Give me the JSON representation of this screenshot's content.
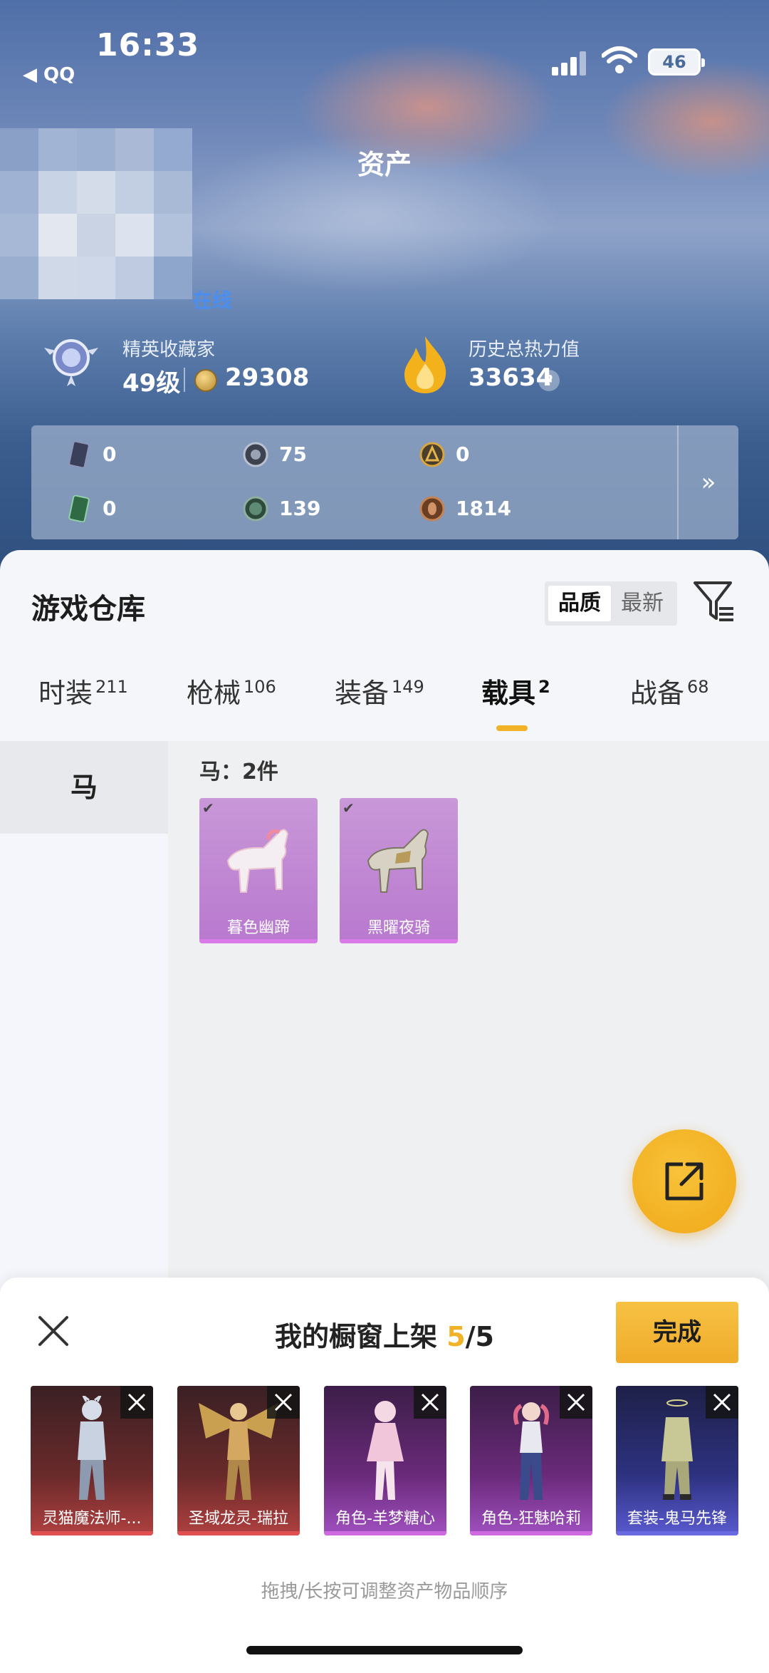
{
  "status_bar": {
    "time": "16:33",
    "back_app": "◀ QQ",
    "battery": "46"
  },
  "header": {
    "title": "资产",
    "online_text": "在线"
  },
  "stats": {
    "collector_title": "精英收藏家",
    "level": "49级",
    "collector_points": "29308",
    "heat_label": "历史总热力值",
    "heat_value": "33634",
    "help": "?"
  },
  "currencies": [
    {
      "icon": "card-icon",
      "value": "0"
    },
    {
      "icon": "silver-coin-icon",
      "value": "75"
    },
    {
      "icon": "gold-badge-icon",
      "value": "0"
    },
    {
      "icon": "green-card-icon",
      "value": "0"
    },
    {
      "icon": "green-orb-icon",
      "value": "139"
    },
    {
      "icon": "bronze-coin-icon",
      "value": "1814"
    }
  ],
  "expand": "»",
  "warehouse": {
    "title": "游戏仓库",
    "sort_options": [
      "品质",
      "最新"
    ],
    "tabs": [
      {
        "label": "时装",
        "count": "211"
      },
      {
        "label": "枪械",
        "count": "106"
      },
      {
        "label": "装备",
        "count": "149"
      },
      {
        "label": "载具",
        "count": "2"
      },
      {
        "label": "战备",
        "count": "68"
      }
    ],
    "active_tab": "载具",
    "sidebar_items": [
      "马"
    ],
    "count_text": "马：2件",
    "items": [
      {
        "name": "暮色幽蹄",
        "checked": true
      },
      {
        "name": "黑曜夜骑",
        "checked": true
      }
    ]
  },
  "shelf": {
    "title_prefix": "我的橱窗上架 ",
    "count_current": "5",
    "count_total": "/5",
    "done_label": "完成",
    "items": [
      {
        "name": "灵猫魔法师-...",
        "rarity_color": "#a83a3a"
      },
      {
        "name": "圣域龙灵-瑞拉",
        "rarity_color": "#a83a3a"
      },
      {
        "name": "角色-羊梦糖心",
        "rarity_color": "#8a3aa8"
      },
      {
        "name": "角色-狂魅哈莉",
        "rarity_color": "#8a3aa8"
      },
      {
        "name": "套装-鬼马先锋",
        "rarity_color": "#4a4ab0"
      }
    ],
    "hint": "拖拽/长按可调整资产物品顺序"
  },
  "colors": {
    "accent": "#f2b228",
    "purple_rarity": "#b878cf",
    "red_rarity": "#a83a3a"
  }
}
